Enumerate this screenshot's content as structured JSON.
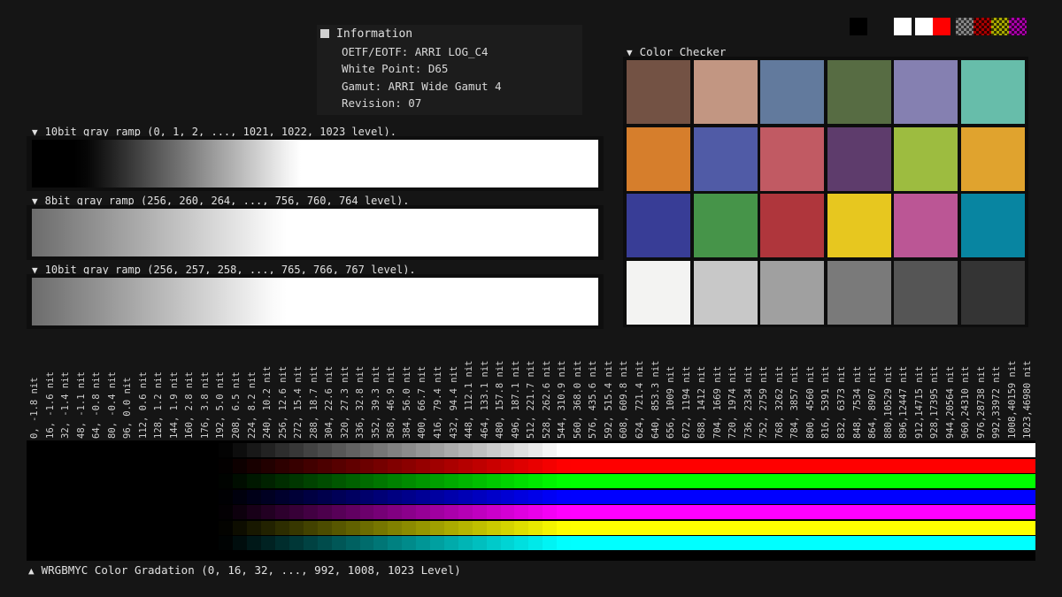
{
  "info": {
    "title": "Information",
    "lines": [
      "OETF/EOTF: ARRI LOG_C4",
      "White Point: D65",
      "Gamut: ARRI Wide Gamut 4",
      "Revision: 07"
    ]
  },
  "ramps": [
    {
      "label": "10bit gray ramp (0, 1, 2, ..., 1021, 1022, 1023 level).",
      "start": 0,
      "step": 1,
      "end": 1023
    },
    {
      "label": "8bit gray ramp (256, 260, 264, ..., 756, 760, 764 level).",
      "start": 256,
      "step": 4,
      "end": 764
    },
    {
      "label": "10bit gray ramp (256, 257, 258, ..., 765, 766, 767 level).",
      "start": 256,
      "step": 1,
      "end": 767
    }
  ],
  "color_checker": {
    "title": "Color Checker",
    "colors": [
      "#735244",
      "#c29682",
      "#627a9d",
      "#576c43",
      "#8580b1",
      "#67bdaa",
      "#d67e2c",
      "#505ba6",
      "#c15a63",
      "#5e3c6c",
      "#9dbc40",
      "#e0a32e",
      "#383d96",
      "#469449",
      "#af363c",
      "#e7c71f",
      "#bb5695",
      "#0885a1",
      "#f3f3f2",
      "#c8c8c8",
      "#a0a0a0",
      "#7a7a7a",
      "#555555",
      "#343434"
    ]
  },
  "top_swatches": [
    "#000000",
    "#151515",
    "#ffffff",
    "#ffffff",
    "#ff0000"
  ],
  "nit_labels": [
    "0, -1.8 nit",
    "16, -1.6 nit",
    "32, -1.4 nit",
    "48, -1.1 nit",
    "64, -0.8 nit",
    "80, -0.4 nit",
    "96, 0.0 nit",
    "112, 0.6 nit",
    "128, 1.2 nit",
    "144, 1.9 nit",
    "160, 2.8 nit",
    "176, 3.8 nit",
    "192, 5.0 nit",
    "208, 6.5 nit",
    "224, 8.2 nit",
    "240, 10.2 nit",
    "256, 12.6 nit",
    "272, 15.4 nit",
    "288, 18.7 nit",
    "304, 22.6 nit",
    "320, 27.3 nit",
    "336, 32.8 nit",
    "352, 39.3 nit",
    "368, 46.9 nit",
    "384, 56.0 nit",
    "400, 66.7 nit",
    "416, 79.4 nit",
    "432, 94.4 nit",
    "448, 112.1 nit",
    "464, 133.1 nit",
    "480, 157.8 nit",
    "496, 187.1 nit",
    "512, 221.7 nit",
    "528, 262.6 nit",
    "544, 310.9 nit",
    "560, 368.0 nit",
    "576, 435.6 nit",
    "592, 515.4 nit",
    "608, 609.8 nit",
    "624, 721.4 nit",
    "640, 853.3 nit",
    "656, 1009 nit",
    "672, 1194 nit",
    "688, 1412 nit",
    "704, 1669 nit",
    "720, 1974 nit",
    "736, 2334 nit",
    "752, 2759 nit",
    "768, 3262 nit",
    "784, 3857 nit",
    "800, 4560 nit",
    "816, 5391 nit",
    "832, 6373 nit",
    "848, 7534 nit",
    "864, 8907 nit",
    "880,10529 nit",
    "896,12447 nit",
    "912,14715 nit",
    "928,17395 nit",
    "944,20564 nit",
    "960,24310 nit",
    "976,28738 nit",
    "992,33972 nit",
    "1008,40159 nit",
    "1023,46980 nit"
  ],
  "gradation": {
    "label": "WRGBMYC Color Gradation (0, 16, 32, ..., 992, 1008, 1023 Level)",
    "rows": [
      {
        "name": "white",
        "rgb": [
          1,
          1,
          1
        ],
        "clip": 20
      },
      {
        "name": "red",
        "rgb": [
          1,
          0,
          0
        ],
        "clip": 22
      },
      {
        "name": "green",
        "rgb": [
          0,
          1,
          0
        ],
        "clip": 60
      },
      {
        "name": "blue",
        "rgb": [
          0,
          0,
          1
        ],
        "clip": 53
      },
      {
        "name": "magenta",
        "rgb": [
          1,
          0,
          1
        ],
        "clip": 20
      },
      {
        "name": "yellow",
        "rgb": [
          1,
          1,
          0
        ],
        "clip": 21
      },
      {
        "name": "cyan",
        "rgb": [
          0,
          1,
          1
        ],
        "clip": 19
      }
    ]
  },
  "arrows": {
    "down": "▼",
    "up": "▲"
  }
}
